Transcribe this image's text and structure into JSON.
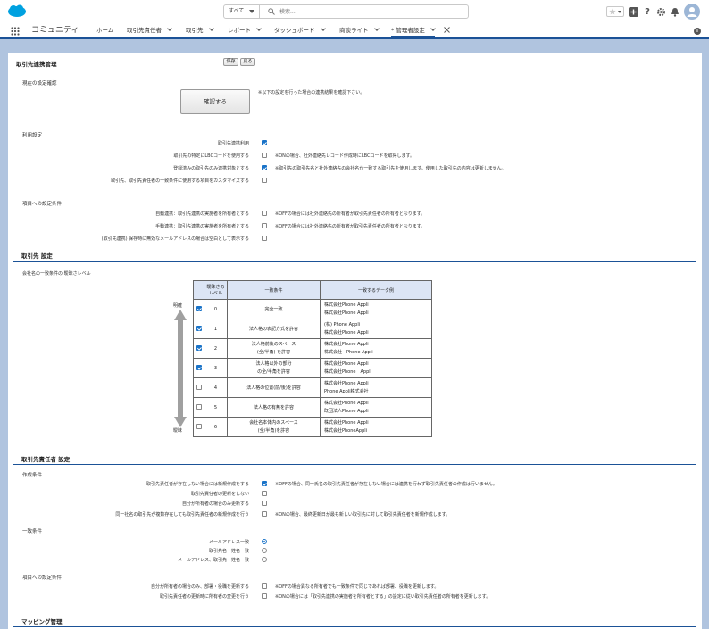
{
  "header": {
    "search_scope": "すべて",
    "search_placeholder": "検索..."
  },
  "nav": {
    "app_name": "コミュニティ",
    "tabs": [
      {
        "label": "ホーム",
        "chevron": false
      },
      {
        "label": "取引先責任者",
        "chevron": true
      },
      {
        "label": "取引先",
        "chevron": true
      },
      {
        "label": "レポート",
        "chevron": true
      },
      {
        "label": "ダッシュボード",
        "chevron": true
      },
      {
        "label": "商談ライト",
        "chevron": true
      },
      {
        "label": "* 管理者設定",
        "chevron": true
      }
    ]
  },
  "page": {
    "title": "取引先連携管理",
    "save_label": "保存",
    "back_label": "戻る"
  },
  "current": {
    "heading": "現在の設定確認",
    "confirm_label": "確認する",
    "confirm_note": "※以下の設定を行った場合の連携結果を確認下さい。"
  },
  "usage": {
    "heading": "利用設定",
    "rows": [
      {
        "label": "取引先連携利用",
        "checked": true,
        "note": ""
      },
      {
        "label": "取引先の特定にLBCコードを使用する",
        "checked": false,
        "note": "※ONの場合、社外連絡先レコード作成時にLBCコードを取得します。"
      },
      {
        "label": "登録済みの取引先のみ連携対象とする",
        "checked": true,
        "note": "※取引先の取引先名と社外連絡先の会社名が一致する取引先を使用します。使用した取引先の内容は更新しません。"
      },
      {
        "label": "取引先、取引先責任者の一致条件に使用する項目をカスタマイズする",
        "checked": false,
        "note": ""
      }
    ]
  },
  "field_settings": {
    "heading": "項目への設定条件",
    "rows": [
      {
        "label": "自動連携：取引先連携の実施者を所有者とする",
        "checked": false,
        "note": "※OFFの場合には社外連絡先の所有者が取引先責任者の所有者となります。"
      },
      {
        "label": "手動連携：取引先連携の実施者を所有者とする",
        "checked": false,
        "note": "※OFFの場合には社外連絡先の所有者が取引先責任者の所有者となります。"
      },
      {
        "label": "(取引先連携) 保存時に無効なメールアドレスの場合は空白として表示する",
        "checked": false,
        "note": ""
      }
    ]
  },
  "account": {
    "heading": "取引先 設定",
    "sub": "会社名の一致条件の 曖昧さレベル",
    "arrow_top": "明確",
    "arrow_bottom": "曖昧",
    "col_level": "曖昧さのレベル",
    "col_cond": "一致条件",
    "col_example": "一致するデータ例",
    "rows": [
      {
        "checked": true,
        "level": "0",
        "cond": [
          "完全一致"
        ],
        "ex": [
          "株式会社Phone Appli",
          "株式会社Phone Appli"
        ]
      },
      {
        "checked": true,
        "level": "1",
        "cond": [
          "法人格の表記方式を許容"
        ],
        "ex": [
          "(株) Phone Appli",
          "株式会社Phone Appli"
        ]
      },
      {
        "checked": true,
        "level": "2",
        "cond": [
          "法人格前後のスペース",
          "(全/半角) を許容"
        ],
        "ex": [
          "株式会社Phone Appli",
          "株式会社　Phone Appli"
        ]
      },
      {
        "checked": true,
        "level": "3",
        "cond": [
          "法人格以外の部分",
          "の全/半角を許容"
        ],
        "ex": [
          "株式会社Phone Appli",
          "株式会社Phone　Appli"
        ]
      },
      {
        "checked": false,
        "level": "4",
        "cond": [
          "法人格の位置(前/後)を許容"
        ],
        "ex": [
          "株式会社Phone Appli",
          "Phone Appli株式会社"
        ]
      },
      {
        "checked": false,
        "level": "5",
        "cond": [
          "法人格の有無を許容"
        ],
        "ex": [
          "株式会社Phone Appli",
          "既団法人Phone Appli"
        ]
      },
      {
        "checked": false,
        "level": "6",
        "cond": [
          "会社名本体内のスペース",
          "(全/半角)を許容"
        ],
        "ex": [
          "株式会社Phone Appli",
          "株式会社PhoneAppli"
        ]
      }
    ]
  },
  "contact": {
    "heading": "取引先責任者 設定",
    "create_heading": "作成条件",
    "create_rows": [
      {
        "label": "取引先責任者が存在しない場合には新規作成をする",
        "checked": true,
        "note": "※OFFの場合、同一氏名の取引先責任者が存在しない場合には連携を行わず取引先責任者の作成は行いません。"
      },
      {
        "label": "取引先責任者の更新をしない",
        "checked": false,
        "note": ""
      },
      {
        "label": "自分が所有者の場合のみ更新する",
        "checked": false,
        "note": ""
      },
      {
        "label": "同一社名の取引先が複数存在しても取引先責任者の新規作成を行う",
        "checked": false,
        "note": "※ONの場合、最終更新日が最も新しい取引先に対して取引先責任者を新規作成します。"
      }
    ],
    "match_heading": "一致条件",
    "match_rows": [
      {
        "label": "メールアドレス一致",
        "selected": true
      },
      {
        "label": "取引先名・姓名一致",
        "selected": false
      },
      {
        "label": "メールアドレス、取引先・姓名一致",
        "selected": false
      }
    ],
    "field_heading": "項目への設定条件",
    "field_rows": [
      {
        "label": "自分が所有者の場合のみ、部署・役職を更新する",
        "checked": false,
        "note": "※OFFの場合異なる所有者でも一致条件で同じであれば部署、役職を更新します。"
      },
      {
        "label": "取引先責任者の更新時に所有者の変更を行う",
        "checked": false,
        "note": "※ONの場合には「取引先連携の実施者を所有者とする」の設定に従い取引先責任者の所有者を更新します。"
      }
    ]
  },
  "mapping": {
    "heading": "マッピング管理"
  },
  "colors": {
    "brand": "#1b5297",
    "check": "#1a73c8",
    "background": "#b0c4df",
    "table_header": "#dce5f5"
  }
}
